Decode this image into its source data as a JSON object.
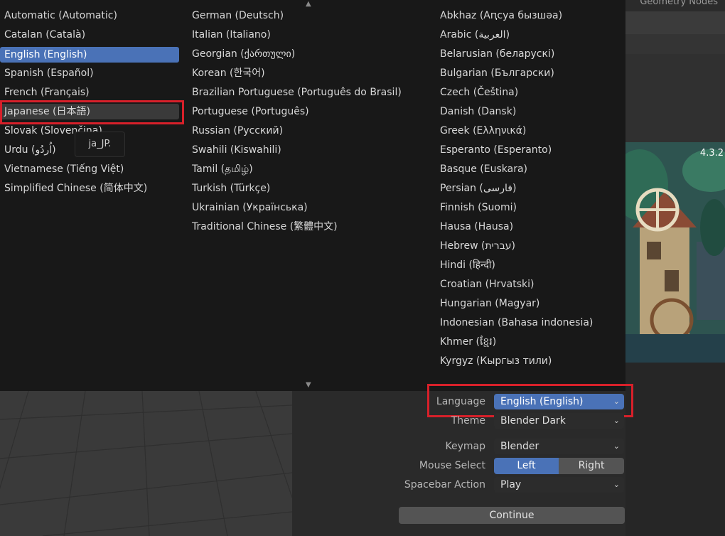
{
  "header_tab": "Geometry Nodes",
  "version": "4.3.2",
  "menu": {
    "col1": [
      "Automatic (Automatic)",
      "Catalan (Català)",
      "English (English)",
      "Spanish (Español)",
      "French (Français)",
      "Japanese (日本語)",
      "Slovak (Slovenčina)",
      "Urdu (اُردُو)",
      "Vietnamese (Tiếng Việt)",
      "Simplified Chinese (简体中文)"
    ],
    "col2": [
      "German (Deutsch)",
      "Italian (Italiano)",
      "Georgian (ქართული)",
      "Korean (한국어)",
      "Brazilian Portuguese (Português do Brasil)",
      "Portuguese (Português)",
      "Russian (Русский)",
      "Swahili (Kiswahili)",
      "Tamil (தமிழ்)",
      "Turkish (Türkçe)",
      "Ukrainian (Українська)",
      "Traditional Chinese (繁體中文)"
    ],
    "col3": [
      "Abkhaz (Аԥсуа бызшәа)",
      "Arabic (العربية)",
      "Belarusian (беларускі)",
      "Bulgarian (Български)",
      "Czech (Čeština)",
      "Danish (Dansk)",
      "Greek (Ελληνικά)",
      "Esperanto (Esperanto)",
      "Basque (Euskara)",
      "Persian (فارسی)",
      "Finnish (Suomi)",
      "Hausa (Hausa)",
      "Hebrew (עברית)",
      "Hindi (हिन्दी)",
      "Croatian (Hrvatski)",
      "Hungarian (Magyar)",
      "Indonesian (Bahasa indonesia)",
      "Khmer (ខ្មែរ)",
      "Kyrgyz (Кыргыз тили)"
    ],
    "tooltip": "ja_JP.",
    "up_arrow": "▲",
    "down_arrow": "▼"
  },
  "prefs": {
    "language_label": "Language",
    "language_value": "English (English)",
    "theme_label": "Theme",
    "theme_value": "Blender Dark",
    "keymap_label": "Keymap",
    "keymap_value": "Blender",
    "mouse_select_label": "Mouse Select",
    "mouse_left": "Left",
    "mouse_right": "Right",
    "spacebar_label": "Spacebar Action",
    "spacebar_value": "Play",
    "continue": "Continue",
    "chevron": "⌄"
  },
  "colors": {
    "accent": "#4a72b7",
    "highlight_box": "#d7202a"
  }
}
